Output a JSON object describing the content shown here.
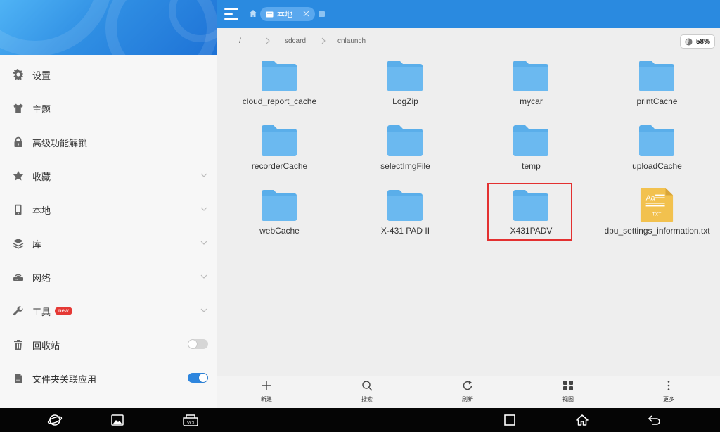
{
  "sidebar": {
    "items": [
      {
        "label": "设置",
        "icon": "gear-icon"
      },
      {
        "label": "主题",
        "icon": "shirt-icon"
      },
      {
        "label": "高级功能解锁",
        "icon": "lock-icon"
      },
      {
        "label": "收藏",
        "icon": "star-icon",
        "expandable": true
      },
      {
        "label": "本地",
        "icon": "phone-icon",
        "expandable": true
      },
      {
        "label": "库",
        "icon": "layers-icon",
        "expandable": true
      },
      {
        "label": "网络",
        "icon": "network-icon",
        "expandable": true
      },
      {
        "label": "工具",
        "icon": "wrench-icon",
        "expandable": true,
        "badge": "new"
      },
      {
        "label": "回收站",
        "icon": "trash-icon",
        "toggle": "off"
      },
      {
        "label": "文件夹关联应用",
        "icon": "file-link-icon",
        "toggle": "on"
      }
    ]
  },
  "header": {
    "tab_label": "本地"
  },
  "breadcrumb": [
    "/",
    "sdcard",
    "cnlaunch"
  ],
  "storage": {
    "percent": "58%",
    "value": 58
  },
  "files": [
    {
      "name": "cloud_report_cache",
      "type": "folder"
    },
    {
      "name": "LogZip",
      "type": "folder"
    },
    {
      "name": "mycar",
      "type": "folder"
    },
    {
      "name": "printCache",
      "type": "folder"
    },
    {
      "name": "recorderCache",
      "type": "folder"
    },
    {
      "name": "selectImgFile",
      "type": "folder"
    },
    {
      "name": "temp",
      "type": "folder"
    },
    {
      "name": "uploadCache",
      "type": "folder"
    },
    {
      "name": "webCache",
      "type": "folder"
    },
    {
      "name": "X-431 PAD II",
      "type": "folder"
    },
    {
      "name": "X431PADV",
      "type": "folder",
      "highlighted": true
    },
    {
      "name": "dpu_settings_information.txt",
      "type": "txt",
      "icon_label_top": "Aa",
      "icon_label_bottom": "TXT"
    }
  ],
  "toolbar": {
    "new_label": "新建",
    "search_label": "搜索",
    "refresh_label": "刷新",
    "view_label": "视图",
    "more_label": "更多"
  },
  "navbar": {
    "vci_label": "VCI"
  },
  "colors": {
    "accent": "#2a8ae0",
    "folder": "#5aaeea",
    "highlight": "#e33030",
    "toggle_on": "#2e86de",
    "badge": "#e53935",
    "txt_icon": "#f2c14e"
  }
}
